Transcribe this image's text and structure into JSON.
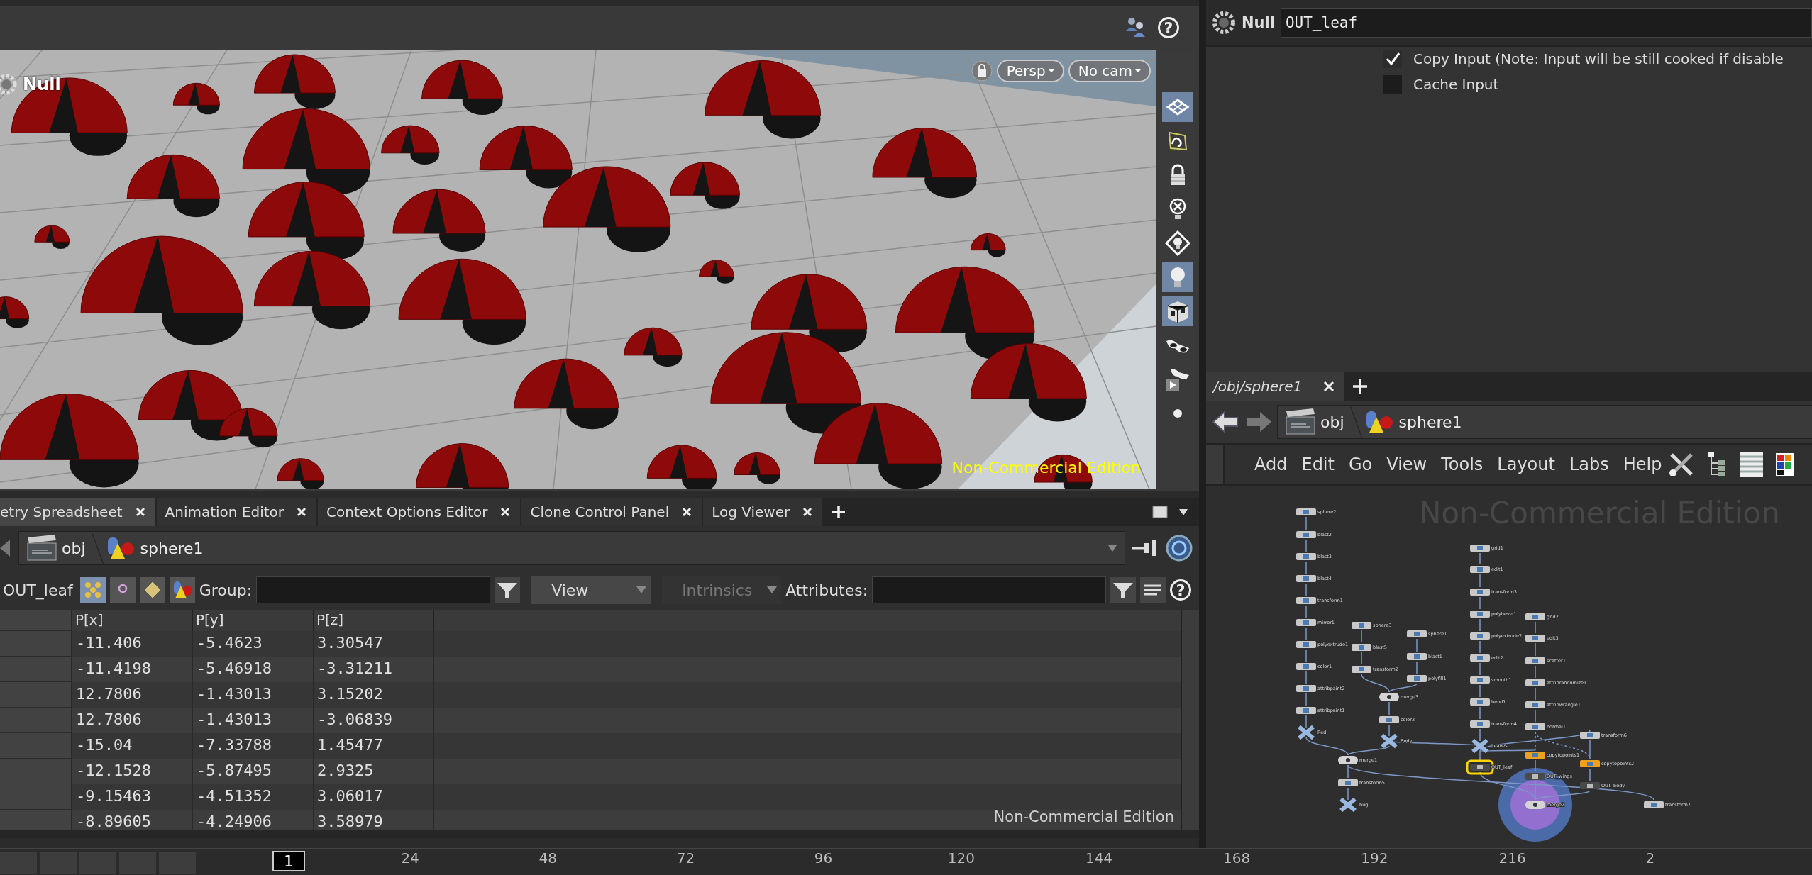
{
  "top_help": "?",
  "viewport": {
    "title": "Null",
    "view": "Persp",
    "camera": "No cam",
    "watermark": "Non-Commercial Edition",
    "tools": [
      {
        "kind": "grid",
        "on": true
      },
      {
        "kind": "curve",
        "on": false
      },
      {
        "kind": "lock",
        "on": false
      },
      {
        "kind": "light-off",
        "on": false
      },
      {
        "kind": "light-diamond",
        "on": false
      },
      {
        "kind": "light",
        "on": true
      },
      {
        "kind": "shade",
        "on": true
      },
      {
        "kind": "glasses",
        "on": false
      },
      {
        "kind": "glasses-play",
        "on": false
      },
      {
        "kind": "ball",
        "on": false
      }
    ]
  },
  "parameters": {
    "type": "Null",
    "name": "OUT_leaf",
    "options": [
      {
        "label": "Copy Input (Note: Input will be still cooked if disable",
        "checked": true
      },
      {
        "label": "Cache Input",
        "checked": false
      }
    ]
  },
  "bottom_tabs": [
    {
      "label": "etry Spreadsheet",
      "selected": true
    },
    {
      "label": "Animation Editor",
      "selected": false
    },
    {
      "label": "Context Options Editor",
      "selected": false
    },
    {
      "label": "Clone Control Panel",
      "selected": false
    },
    {
      "label": "Log Viewer",
      "selected": false
    }
  ],
  "spreadsheet": {
    "path": [
      {
        "label": "obj",
        "kind": "network"
      },
      {
        "label": "sphere1",
        "kind": "geometry"
      }
    ],
    "node": "OUT_leaf",
    "group_label": "Group:",
    "dropdowns": [
      {
        "label": "View",
        "disabled": false
      },
      {
        "label": "Intrinsics",
        "disabled": true
      }
    ],
    "attributes_label": "Attributes:",
    "help": "?",
    "columns": [
      "P[x]",
      "P[y]",
      "P[z]"
    ],
    "rows": [
      [
        "-11.406",
        "-5.4623",
        "3.30547"
      ],
      [
        "-11.4198",
        "-5.46918",
        "-3.31211"
      ],
      [
        "12.7806",
        "-1.43013",
        "3.15202"
      ],
      [
        "12.7806",
        "-1.43013",
        "-3.06839"
      ],
      [
        "-15.04",
        "-7.33788",
        "1.45477"
      ],
      [
        "-12.1528",
        "-5.87495",
        "2.9325"
      ],
      [
        "-9.15463",
        "-4.51352",
        "3.06017"
      ],
      [
        "-8.89605",
        "-4.24906",
        "3.58979"
      ]
    ],
    "watermark": "Non-Commercial Edition"
  },
  "network": {
    "tab": "/obj/sphere1",
    "path": [
      {
        "label": "obj",
        "kind": "network"
      },
      {
        "label": "sphere1",
        "kind": "geometry"
      }
    ],
    "menu": [
      "Add",
      "Edit",
      "Go",
      "View",
      "Tools",
      "Layout",
      "Labs",
      "Help"
    ],
    "watermark": "Non-Commercial Edition",
    "nodes": [
      {
        "label": "sphere2",
        "kind": "sop",
        "selected": false,
        "display": false
      },
      {
        "label": "blast2",
        "kind": "sop",
        "selected": false,
        "display": false
      },
      {
        "label": "blast3",
        "kind": "sop",
        "selected": false,
        "display": false
      },
      {
        "label": "blast4",
        "kind": "sop",
        "selected": false,
        "display": false
      },
      {
        "label": "transform1",
        "kind": "sop",
        "selected": false,
        "display": false
      },
      {
        "label": "mirror1",
        "kind": "sop",
        "selected": false,
        "display": false
      },
      {
        "label": "polyextrude1",
        "kind": "sop",
        "selected": false,
        "display": false
      },
      {
        "label": "color1",
        "kind": "sop",
        "selected": false,
        "display": false
      },
      {
        "label": "attribpaint2",
        "kind": "sop",
        "selected": false,
        "display": false
      },
      {
        "label": "attribpaint1",
        "kind": "sop",
        "selected": false,
        "display": false
      },
      {
        "label": "Red",
        "kind": "null",
        "selected": false,
        "display": false
      },
      {
        "label": "sphere3",
        "kind": "sop",
        "selected": false,
        "display": false
      },
      {
        "label": "blast5",
        "kind": "sop",
        "selected": false,
        "display": false
      },
      {
        "label": "transform2",
        "kind": "sop",
        "selected": false,
        "display": false
      },
      {
        "label": "sphere1",
        "kind": "sop",
        "selected": false,
        "display": false
      },
      {
        "label": "blast1",
        "kind": "sop",
        "selected": false,
        "display": false
      },
      {
        "label": "polyfill1",
        "kind": "sop",
        "selected": false,
        "display": false
      },
      {
        "label": "merge3",
        "kind": "merge",
        "selected": false,
        "display": false
      },
      {
        "label": "color2",
        "kind": "sop",
        "selected": false,
        "display": false
      },
      {
        "label": "Body",
        "kind": "null",
        "selected": false,
        "display": false
      },
      {
        "label": "merge1",
        "kind": "merge",
        "selected": false,
        "display": false
      },
      {
        "label": "transform5",
        "kind": "sop",
        "selected": false,
        "display": false
      },
      {
        "label": "bug",
        "kind": "null",
        "selected": false,
        "display": false
      },
      {
        "label": "grid1",
        "kind": "sop",
        "selected": false,
        "display": false
      },
      {
        "label": "edit1",
        "kind": "sop",
        "selected": false,
        "display": false
      },
      {
        "label": "transform3",
        "kind": "sop",
        "selected": false,
        "display": false
      },
      {
        "label": "polybevel1",
        "kind": "sop",
        "selected": false,
        "display": false
      },
      {
        "label": "polyextrude2",
        "kind": "sop",
        "selected": false,
        "display": false
      },
      {
        "label": "edit2",
        "kind": "sop",
        "selected": false,
        "display": false
      },
      {
        "label": "smooth1",
        "kind": "sop",
        "selected": false,
        "display": false
      },
      {
        "label": "bend1",
        "kind": "sop",
        "selected": false,
        "display": false
      },
      {
        "label": "transform4",
        "kind": "sop",
        "selected": false,
        "display": false
      },
      {
        "label": "Leaves",
        "kind": "null",
        "selected": false,
        "display": false
      },
      {
        "label": "OUT_leaf",
        "kind": "output",
        "selected": true,
        "display": false
      },
      {
        "label": "grid2",
        "kind": "sop",
        "selected": false,
        "display": false
      },
      {
        "label": "edit3",
        "kind": "sop",
        "selected": false,
        "display": false
      },
      {
        "label": "scatter1",
        "kind": "sop",
        "selected": false,
        "display": false
      },
      {
        "label": "attribrandomize1",
        "kind": "sop",
        "selected": false,
        "display": false
      },
      {
        "label": "attribwrangle1",
        "kind": "sop",
        "selected": false,
        "display": false
      },
      {
        "label": "normal1",
        "kind": "sop",
        "selected": false,
        "display": false
      },
      {
        "label": "transform6",
        "kind": "sop",
        "selected": false,
        "display": false
      },
      {
        "label": "copytopoints1",
        "kind": "copy",
        "selected": false,
        "display": false
      },
      {
        "label": "copytopoints2",
        "kind": "copy",
        "selected": false,
        "display": false
      },
      {
        "label": "OUT_wings",
        "kind": "output",
        "selected": false,
        "display": false
      },
      {
        "label": "OUT_body",
        "kind": "output",
        "selected": false,
        "display": false
      },
      {
        "label": "merge2",
        "kind": "merge",
        "selected": false,
        "display": true
      },
      {
        "label": "transform7",
        "kind": "sop",
        "selected": false,
        "display": false
      }
    ]
  },
  "timeline": {
    "frame": "1",
    "ticks": [
      "24",
      "48",
      "72",
      "96",
      "120",
      "144",
      "168",
      "192",
      "216",
      "2"
    ]
  }
}
